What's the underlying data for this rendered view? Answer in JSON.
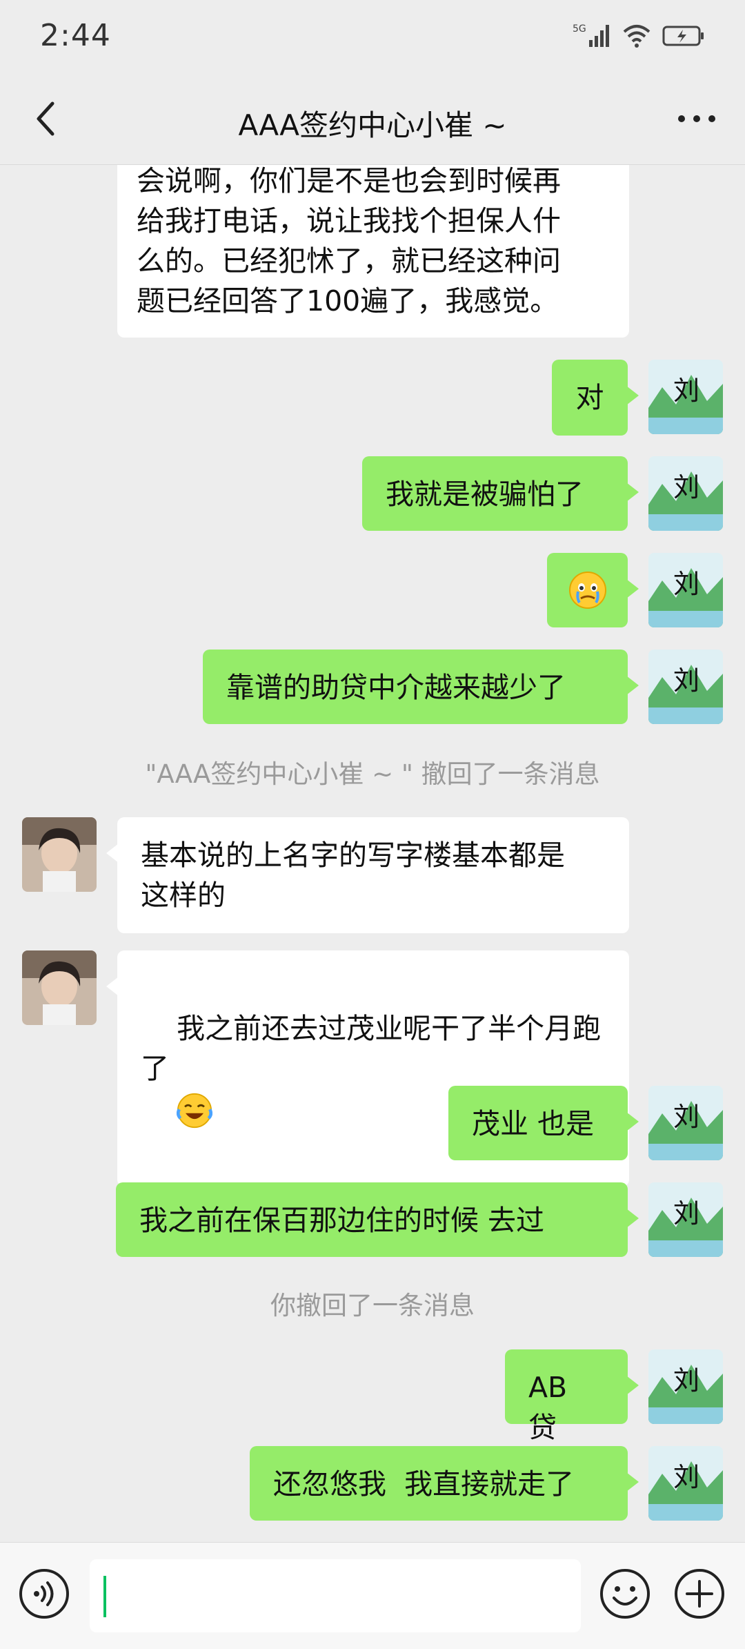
{
  "status_bar": {
    "time": "2:44",
    "network_label": "5G"
  },
  "header": {
    "title": "AAA签约中心小崔 ~",
    "back_icon": "chevron-left-icon",
    "more_icon": "more-dots-icon"
  },
  "messages": [
    {
      "id": 0,
      "side": "them",
      "text": "会说啊，你们是不是也会到时候再\n给我打电话，说让我找个担保人什\n么的。已经犯怵了，就已经这种问\n题已经回答了100遍了，我感觉。"
    },
    {
      "id": 1,
      "side": "me",
      "text": "对"
    },
    {
      "id": 2,
      "side": "me",
      "text": "我就是被骗怕了"
    },
    {
      "id": 3,
      "side": "me",
      "emoji": "crying-face-emoji"
    },
    {
      "id": 4,
      "side": "me",
      "text": "靠谱的助贷中介越来越少了"
    },
    {
      "id": 5,
      "side": "system",
      "text": "\"AAA签约中心小崔 ~ \" 撤回了一条消息"
    },
    {
      "id": 6,
      "side": "them",
      "text": "基本说的上名字的写字楼基本都是\n这样的"
    },
    {
      "id": 7,
      "side": "them",
      "text": "我之前还去过茂业呢干了半个月跑\n了",
      "emoji": "laughing-tears-emoji"
    },
    {
      "id": 8,
      "side": "me",
      "text": "茂业 也是"
    },
    {
      "id": 9,
      "side": "me",
      "text": "我之前在保百那边住的时候 去过"
    },
    {
      "id": 10,
      "side": "system",
      "text": "你撤回了一条消息"
    },
    {
      "id": 11,
      "side": "me",
      "text": "AB 贷"
    },
    {
      "id": 12,
      "side": "me",
      "text": "还忽悠我  我直接就走了"
    }
  ],
  "my_avatar": {
    "char": "刘",
    "icon": "landscape-calligraphy-avatar"
  },
  "their_avatar": {
    "icon": "person-photo-avatar"
  },
  "input_bar": {
    "value": "",
    "voice_icon": "voice-icon",
    "emoji_icon": "smiley-icon",
    "plus_icon": "plus-icon"
  },
  "colors": {
    "background": "#ededed",
    "my_bubble": "#95ec69",
    "their_bubble": "#ffffff",
    "system_text": "#9a9a9a",
    "caret": "#07c160"
  }
}
